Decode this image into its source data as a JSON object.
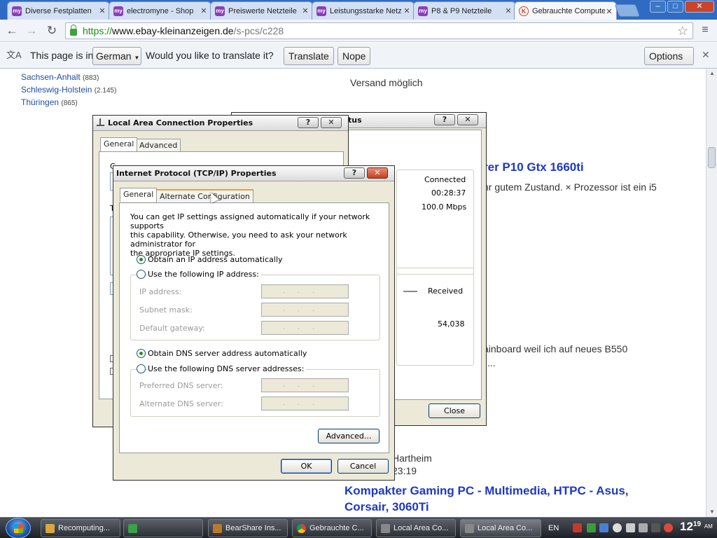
{
  "browser": {
    "tabs": [
      {
        "title": "Diverse Festplatten",
        "favicon": "my"
      },
      {
        "title": "electromyne - Shop",
        "favicon": "my"
      },
      {
        "title": "Preiswerte Netzteile",
        "favicon": "my"
      },
      {
        "title": "Leistungsstarke Netz",
        "favicon": "my"
      },
      {
        "title": "P8 & P9 Netzteile",
        "favicon": "my"
      },
      {
        "title": "Gebrauchte Computer",
        "favicon": "K"
      }
    ],
    "window_controls": {
      "minimize": "–",
      "maximize": "□",
      "close": "✕"
    },
    "url": {
      "scheme": "https://",
      "host": "www.ebay-kleinanzeigen.de",
      "path": "/s-pcs/c228"
    },
    "translate_bar": {
      "prefix": "This page is in",
      "language": "German",
      "question": "Would you like to translate it?",
      "translate": "Translate",
      "nope": "Nope",
      "options": "Options"
    }
  },
  "page": {
    "regions": [
      {
        "name": "Sachsen-Anhalt",
        "count": "(883)"
      },
      {
        "name": "Schleswig-Holstein",
        "count": "(2.145)"
      },
      {
        "name": "Thüringen",
        "count": "(865)"
      }
    ],
    "shipping": "Versand möglich",
    "listing1_title_fragment": "rer P10 Gtx 1660ti",
    "listing1_desc_fragment": "hr gutem Zustand. × Prozessor ist ein i5",
    "listing_text_fragment": "ainboard weil ich auf neues B550",
    "listing_text_ellipsis": "...",
    "location_fragment": "Hartheim",
    "time_fragment": "23:19",
    "listing2_title": [
      "Kompakter Gaming PC - Multimedia, HTPC - Asus,",
      "Corsair, 3060Ti"
    ]
  },
  "status_dialog": {
    "title_fragment": "tus",
    "connected": "Connected",
    "duration": "00:28:37",
    "speed": "100.0 Mbps",
    "received_label": "Received",
    "received_value": "54,038",
    "close": "Close"
  },
  "lan_dialog": {
    "title": "Local Area Connection Properties",
    "tabs": [
      "General",
      "Advanced"
    ],
    "fragment_c": "C",
    "fragment_t": "T"
  },
  "tcpip_dialog": {
    "title": "Internet Protocol (TCP/IP) Properties",
    "tabs": [
      "General",
      "Alternate Configuration"
    ],
    "intro": [
      "You can get IP settings assigned automatically if your network supports",
      "this capability. Otherwise, you need to ask your network administrator for",
      "the appropriate IP settings."
    ],
    "obtain_ip": "Obtain an IP address automatically",
    "use_ip": "Use the following IP address:",
    "ip_address": "IP address:",
    "subnet_mask": "Subnet mask:",
    "default_gateway": "Default gateway:",
    "obtain_dns": "Obtain DNS server address automatically",
    "use_dns": "Use the following DNS server addresses:",
    "preferred_dns": "Preferred DNS server:",
    "alternate_dns": "Alternate DNS server:",
    "ip_placeholder": "...",
    "advanced": "Advanced...",
    "ok": "OK",
    "cancel": "Cancel",
    "help_button": "?",
    "close_button": "✕"
  },
  "taskbar": {
    "items": [
      "Recomputing...",
      "",
      "BearShare Ins...",
      "Gebrauchte C...",
      "Local Area Co...",
      "Local Area Co..."
    ],
    "language": "EN",
    "clock": {
      "hour": "12",
      "minute": "19",
      "ampm": "AM"
    }
  }
}
